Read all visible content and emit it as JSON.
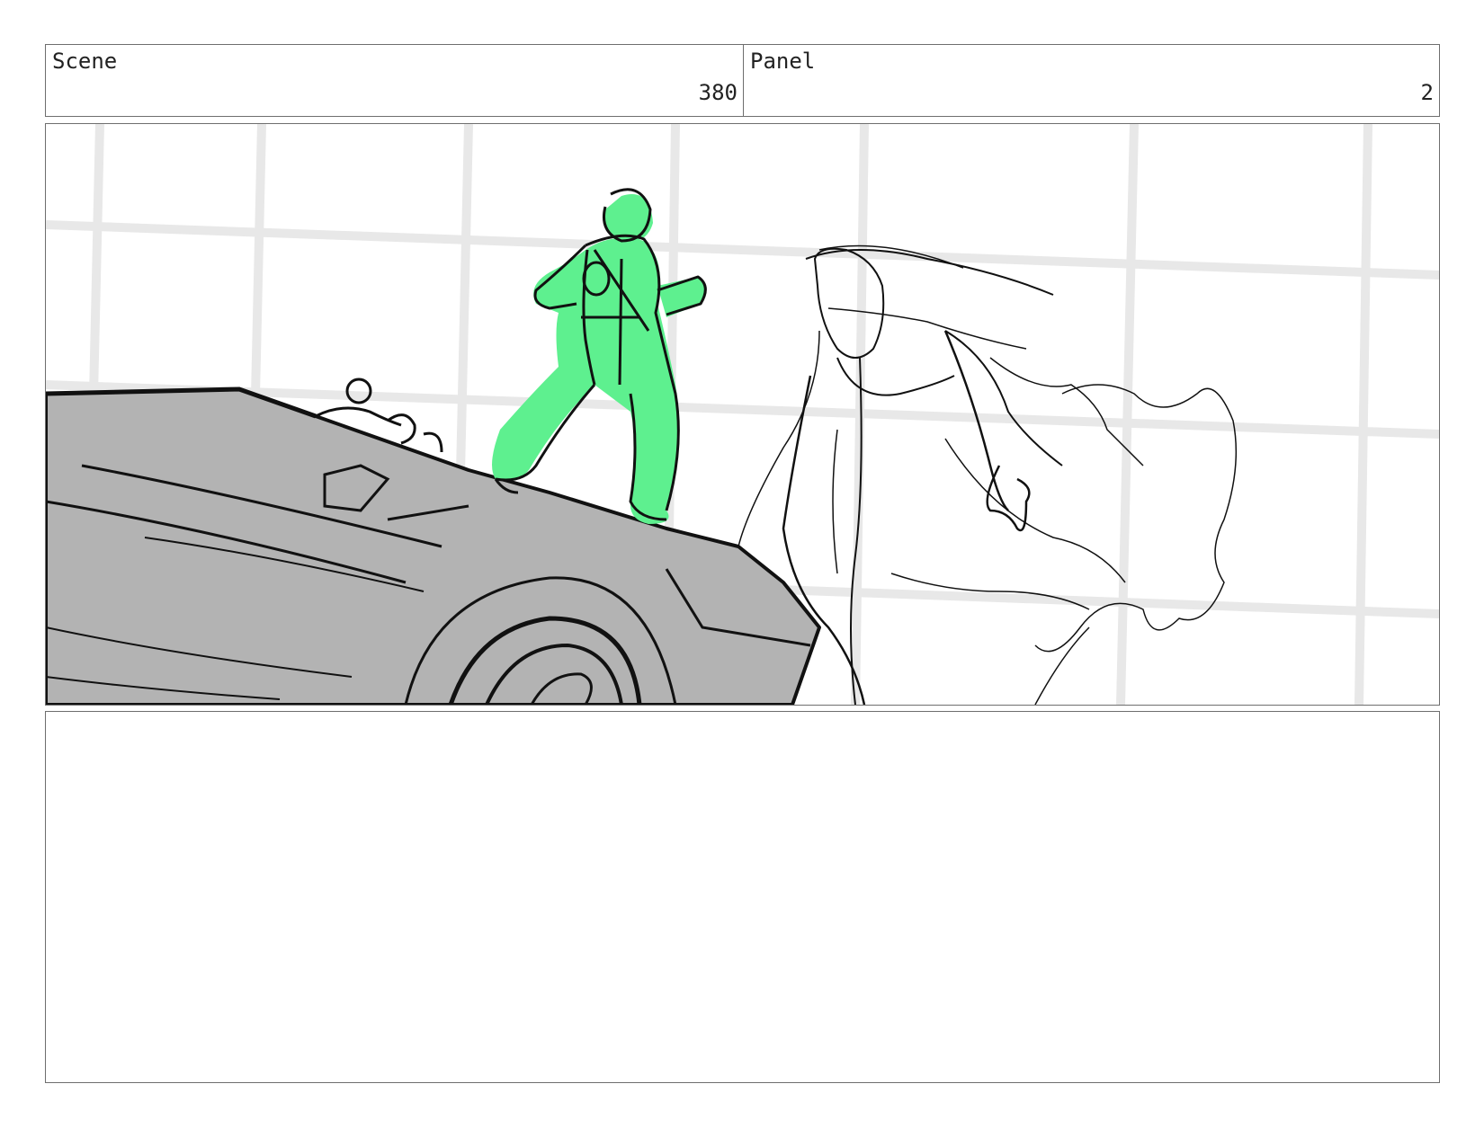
{
  "header": {
    "scene_label": "Scene",
    "scene_number": "380",
    "panel_label": "Panel",
    "panel_number": "2"
  },
  "colors": {
    "character_highlight": "#5ef08f",
    "car_fill": "#b3b3b3",
    "ink": "#111111",
    "background_lines": "#e6e6e6"
  },
  "notes": {
    "text": ""
  }
}
